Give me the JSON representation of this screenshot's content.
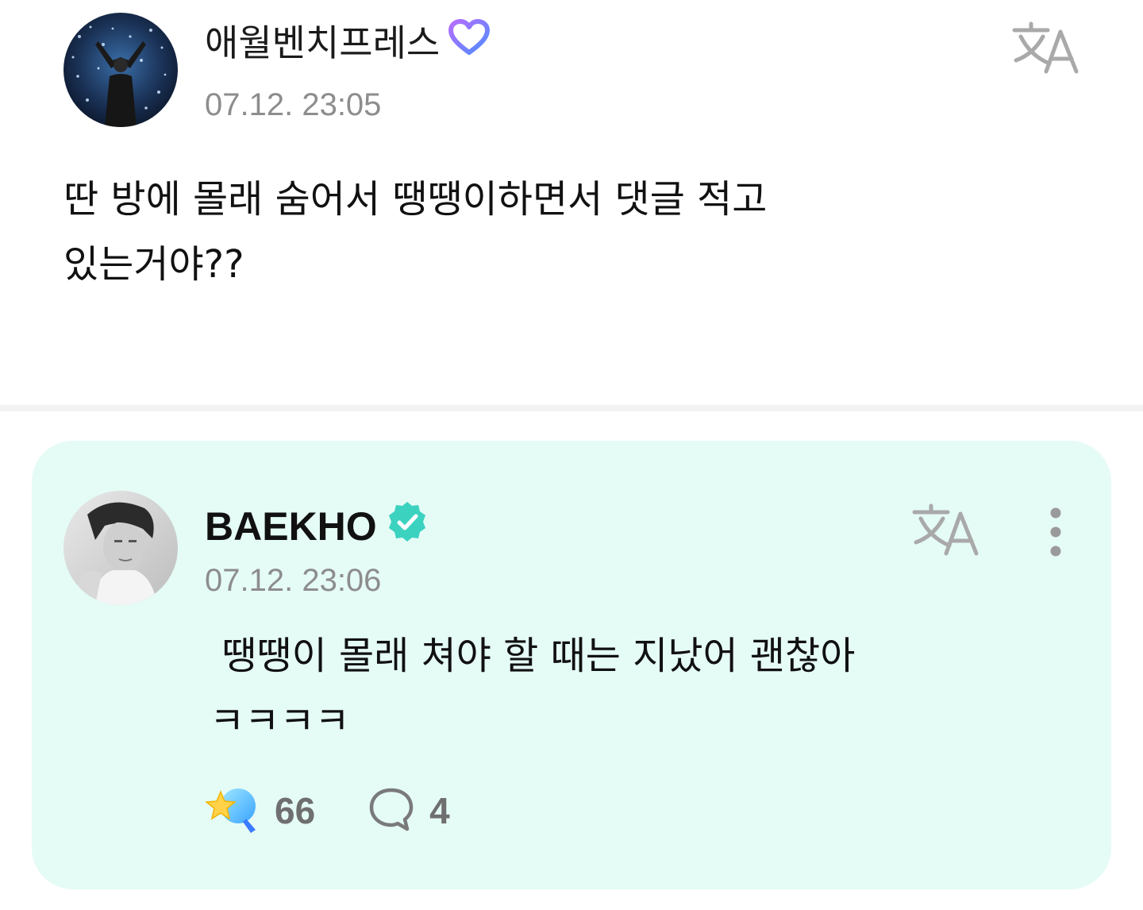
{
  "post": {
    "author": "애월벤치프레스",
    "timestamp": "07.12. 23:05",
    "body": "딴 방에 몰래 숨어서 땡땡이하면서 댓글 적고\n있는거야??",
    "badge_icon": "heart-badge-icon",
    "translate_icon": "translate-icon"
  },
  "reply": {
    "author": "BAEKHO",
    "timestamp": "07.12. 23:06",
    "body": " 땡땡이 몰래 쳐야 할 때는 지났어 괜찮아\nㅋㅋㅋㅋ",
    "badge_icon": "verified-badge-icon",
    "translate_icon": "translate-icon",
    "more_icon": "more-vertical-icon",
    "likes": "66",
    "comments": "4",
    "like_icon": "star-lightstick-icon",
    "comment_icon": "comment-bubble-icon",
    "background_color": "#e5fbf6"
  },
  "colors": {
    "timestamp": "#8d8d8d",
    "verified": "#3bd2c0",
    "heart_badge": "#8a6cff"
  }
}
